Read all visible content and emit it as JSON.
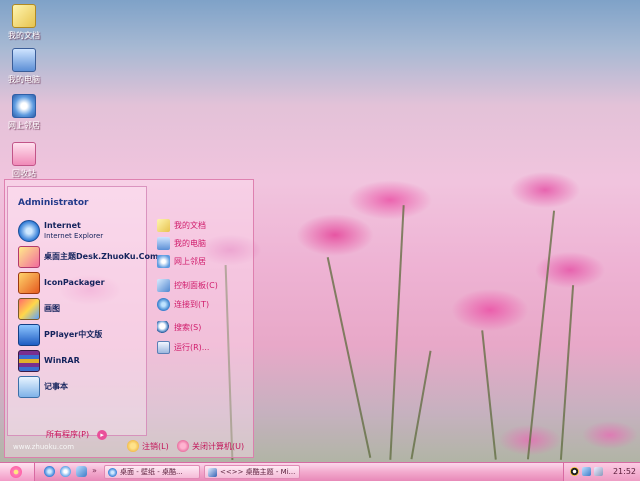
{
  "desktop": {
    "icons": [
      {
        "label": "我的文档",
        "icon": "my-documents-icon"
      },
      {
        "label": "我的电脑",
        "icon": "my-computer-icon"
      },
      {
        "label": "网上邻居",
        "icon": "network-places-icon"
      },
      {
        "label": "回收站",
        "icon": "recycle-bin-icon"
      }
    ]
  },
  "start_menu": {
    "user_name": "Administrator",
    "programs": [
      {
        "name": "Internet",
        "subtitle": "Internet Explorer",
        "icon": "internet-explorer-icon"
      },
      {
        "name": "桌面主题Desk.ZhuoKu.Com",
        "subtitle": "",
        "icon": "desktop-theme-icon"
      },
      {
        "name": "IconPackager",
        "subtitle": "",
        "icon": "iconpackager-icon"
      },
      {
        "name": "画图",
        "subtitle": "",
        "icon": "paint-icon"
      },
      {
        "name": "PPlayer中文版",
        "subtitle": "",
        "icon": "media-player-icon"
      },
      {
        "name": "WinRAR",
        "subtitle": "",
        "icon": "winrar-icon"
      },
      {
        "name": "记事本",
        "subtitle": "",
        "icon": "notepad-icon"
      }
    ],
    "all_programs": "所有程序(P)",
    "places": [
      {
        "label": "我的文档",
        "icon": "my-documents-icon"
      },
      {
        "label": "我的电脑",
        "icon": "my-computer-icon"
      },
      {
        "label": "网上邻居",
        "icon": "network-places-icon"
      },
      {
        "label": "控制面板(C)",
        "icon": "control-panel-icon"
      },
      {
        "label": "连接到(T)",
        "icon": "connect-to-icon"
      },
      {
        "label": "搜索(S)",
        "icon": "search-icon"
      },
      {
        "label": "运行(R)...",
        "icon": "run-icon"
      }
    ],
    "site_text": "www.zhuoku.com",
    "logoff": "注销(L)",
    "shutdown": "关闭计算机(U)"
  },
  "taskbar": {
    "tasks": [
      {
        "label": "桌面 - 壁纸 - 桌酷...",
        "icon": "ie-task-icon"
      },
      {
        "label": "<<>> 桌酷主题 - Mi...",
        "icon": "word-task-icon"
      }
    ],
    "clock": "21:52"
  },
  "colors": {
    "taskbar_pink": "#f3aacd",
    "menu_link": "#d01c6b",
    "program_text": "#14235c"
  }
}
